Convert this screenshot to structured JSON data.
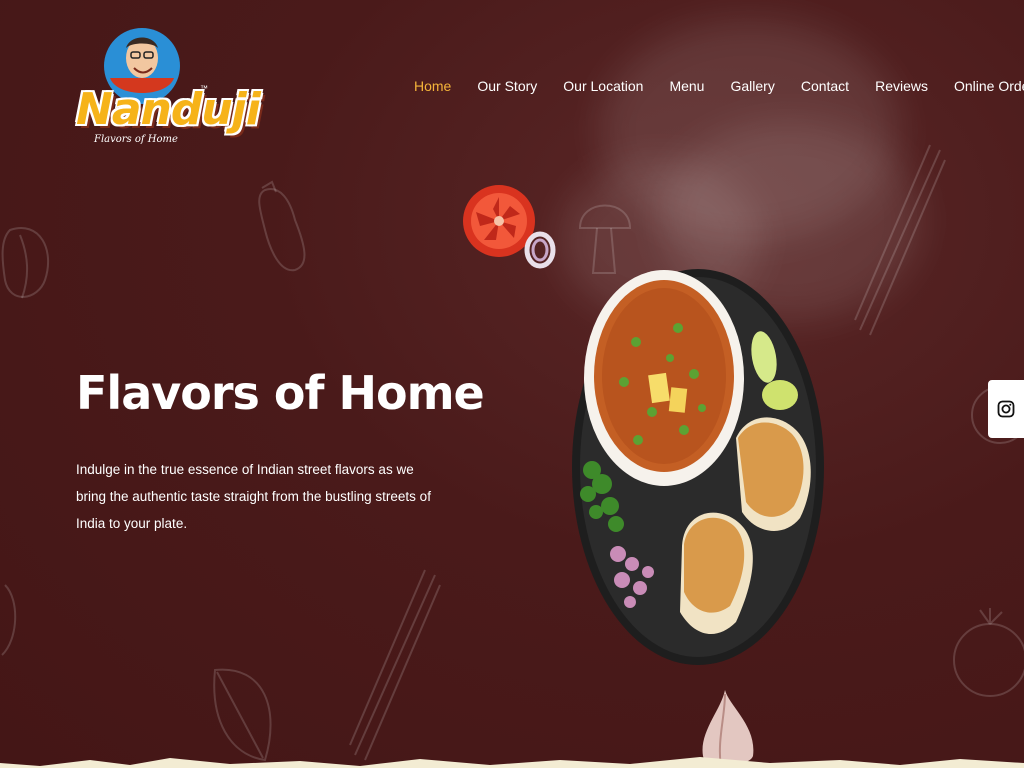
{
  "brand": {
    "name": "Nanduji",
    "trademark": "™",
    "tagline": "Flavors of Home",
    "logo_icon": "mascot-icon"
  },
  "nav": {
    "items": [
      {
        "label": "Home",
        "active": true
      },
      {
        "label": "Our Story",
        "active": false
      },
      {
        "label": "Our Location",
        "active": false
      },
      {
        "label": "Menu",
        "active": false
      },
      {
        "label": "Gallery",
        "active": false
      },
      {
        "label": "Contact",
        "active": false
      },
      {
        "label": "Reviews",
        "active": false
      },
      {
        "label": "Online Order",
        "active": false
      }
    ]
  },
  "hero": {
    "title": "Flavors of Home",
    "description": "Indulge in the true essence of Indian street flavors as we bring the authentic taste straight from the bustling streets of India to your plate."
  },
  "social": {
    "icon": "instagram-icon"
  },
  "colors": {
    "background": "#4a1a1a",
    "accent": "#f4b43a",
    "logo_yellow": "#f6b319",
    "text": "#ffffff"
  }
}
